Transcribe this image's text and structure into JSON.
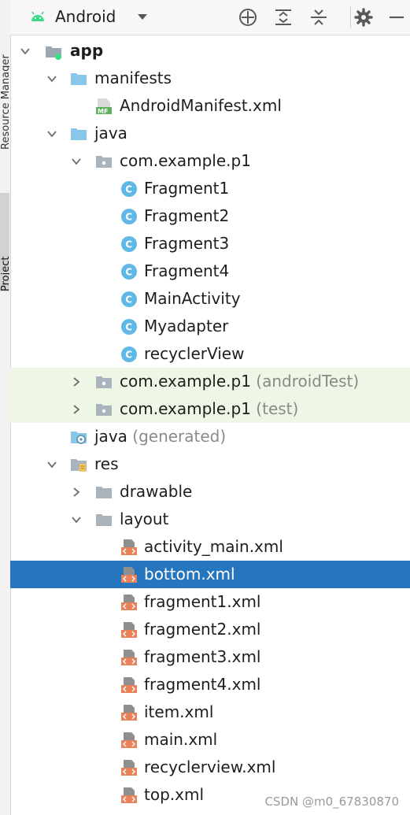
{
  "side": {
    "resource_manager": "Resource Manager",
    "project": "Project"
  },
  "toolbar": {
    "view_title": "Android"
  },
  "tree": {
    "app": "app",
    "manifests": "manifests",
    "android_manifest": "AndroidManifest.xml",
    "java": "java",
    "pkg_main": "com.example.p1",
    "classes": [
      "Fragment1",
      "Fragment2",
      "Fragment3",
      "Fragment4",
      "MainActivity",
      "Myadapter",
      "recyclerView"
    ],
    "pkg_android_test": "com.example.p1",
    "pkg_android_test_suffix": "(androidTest)",
    "pkg_test": "com.example.p1",
    "pkg_test_suffix": "(test)",
    "java_generated": "java",
    "java_generated_suffix": "(generated)",
    "res": "res",
    "drawable": "drawable",
    "layout": "layout",
    "layout_files": [
      "activity_main.xml",
      "bottom.xml",
      "fragment1.xml",
      "fragment2.xml",
      "fragment3.xml",
      "fragment4.xml",
      "item.xml",
      "main.xml",
      "recyclerview.xml",
      "top.xml"
    ],
    "selected_file": "bottom.xml"
  },
  "watermark": "CSDN @m0_67830870",
  "colors": {
    "selection": "#2675bf",
    "test_highlight": "#eef6e6",
    "android_green": "#3ddc84",
    "class_icon": "#5fb8e6",
    "xml_icon": "#e8825a"
  }
}
